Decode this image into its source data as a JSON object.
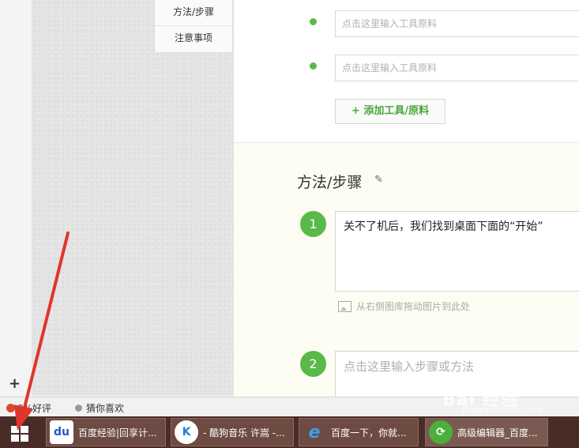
{
  "side_nav": {
    "items": [
      "方法/步骤",
      "注意事项"
    ]
  },
  "tools": {
    "input_placeholder": "点击这里输入工具原料",
    "add_button": "+ 添加工具/原料"
  },
  "method": {
    "title": "方法/步骤",
    "steps": [
      {
        "number": "1",
        "text": "关不了机后，我们找到桌面下面的“开始”"
      },
      {
        "number": "2",
        "placeholder": "点击这里输入步骤或方法"
      }
    ],
    "drag_hint": "从右侧图库拖动图片到此处"
  },
  "sidebar": {
    "plus": "+"
  },
  "statusbar": {
    "rating": "0%好评",
    "guess": "猜你喜欢"
  },
  "taskbar": {
    "items": [
      {
        "label": "百度经验|回享计...",
        "icon": "baidu-paw-icon"
      },
      {
        "label": "- 酷狗音乐 许嵩 -...",
        "icon": "kugou-icon"
      },
      {
        "label": "百度一下，你就...",
        "icon": "ie-icon"
      },
      {
        "label": "高级编辑器_百度...",
        "icon": "refresh-app-icon"
      }
    ]
  },
  "watermark": {
    "main": "Bai 经验",
    "sub": "jingyan.baidu.com"
  },
  "colors": {
    "accent_green": "#5bb84a",
    "taskbar": "#4a2c26",
    "arrow_red": "#e0352b"
  }
}
